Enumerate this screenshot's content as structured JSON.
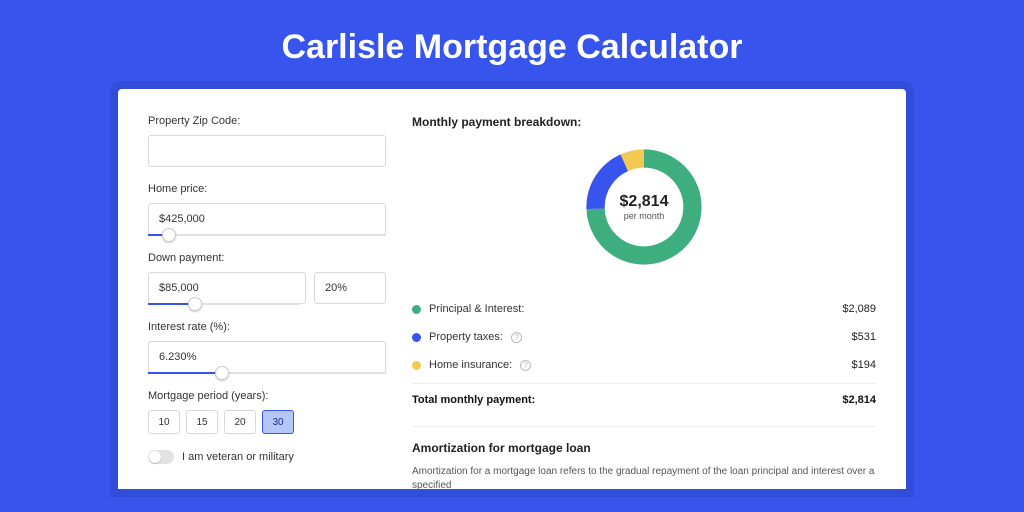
{
  "hero": {
    "title": "Carlisle Mortgage Calculator"
  },
  "form": {
    "zip": {
      "label": "Property Zip Code:",
      "value": ""
    },
    "home_price": {
      "label": "Home price:",
      "value": "$425,000",
      "slider_pct": 9
    },
    "down_payment": {
      "label": "Down payment:",
      "amount": "$85,000",
      "pct": "20%",
      "slider_pct": 20
    },
    "interest": {
      "label": "Interest rate (%):",
      "value": "6.230%",
      "slider_pct": 31
    },
    "period": {
      "label": "Mortgage period (years):",
      "options": [
        "10",
        "15",
        "20",
        "30"
      ],
      "selected": "30"
    },
    "veteran": {
      "label": "I am veteran or military",
      "checked": false
    }
  },
  "breakdown": {
    "title": "Monthly payment breakdown:",
    "center": {
      "amount": "$2,814",
      "suffix": "per month"
    },
    "items": [
      {
        "color": "green",
        "label": "Principal & Interest:",
        "info": false,
        "value": "$2,089"
      },
      {
        "color": "blue",
        "label": "Property taxes:",
        "info": true,
        "value": "$531"
      },
      {
        "color": "yellow",
        "label": "Home insurance:",
        "info": true,
        "value": "$194"
      }
    ],
    "total": {
      "label": "Total monthly payment:",
      "value": "$2,814"
    }
  },
  "amort": {
    "title": "Amortization for mortgage loan",
    "text": "Amortization for a mortgage loan refers to the gradual repayment of the loan principal and interest over a specified"
  },
  "chart_data": {
    "type": "pie",
    "title": "Monthly payment breakdown",
    "series": [
      {
        "name": "Principal & Interest",
        "value": 2089,
        "color": "#3fae7f"
      },
      {
        "name": "Property taxes",
        "value": 531,
        "color": "#3754ed"
      },
      {
        "name": "Home insurance",
        "value": 194,
        "color": "#f4c952"
      }
    ],
    "total": 2814,
    "unit": "USD/month"
  }
}
